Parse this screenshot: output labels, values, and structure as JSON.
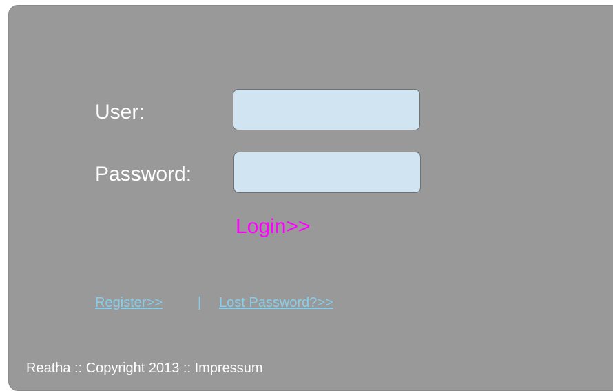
{
  "login_form": {
    "user_label": "User:",
    "password_label": "Password:",
    "user_value": "",
    "password_value": "",
    "login_link": "Login>>",
    "login_color": "#ff00ff"
  },
  "links": {
    "register": "Register>>",
    "separator": "|",
    "lost_password": "Lost Password?>>",
    "link_color": "#87ceeb"
  },
  "footer": {
    "text": "Reatha :: Copyright 2013 :: Impressum"
  },
  "colors": {
    "panel_background": "#999999",
    "input_background": "#d0e4f2"
  }
}
